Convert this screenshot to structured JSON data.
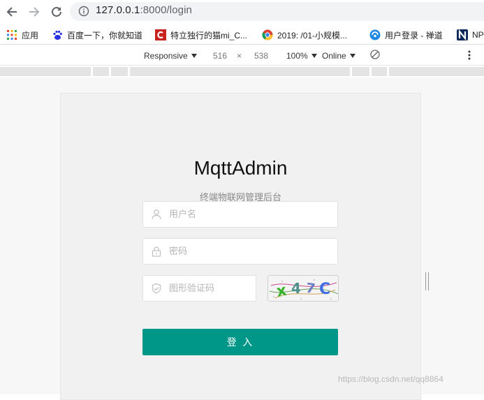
{
  "browser": {
    "url_host": "127.0.0.1",
    "url_path": ":8000/login",
    "bookmarks": [
      {
        "label": "应用",
        "icon": "apps-grid-icon"
      },
      {
        "label": "百度一下，你就知道",
        "icon": "baidu-paw-icon"
      },
      {
        "label": "特立独行的猫mi_C...",
        "icon": "csdn-c-icon"
      },
      {
        "label": "2019: /01-小规模...",
        "icon": "chrome-icon"
      },
      {
        "label": "用户登录 - 禅道",
        "icon": "zentao-icon"
      },
      {
        "label": "NP",
        "icon": "n-logo-icon"
      }
    ]
  },
  "devtools": {
    "device": "Responsive",
    "width": "516",
    "times": "×",
    "height": "538",
    "zoom": "100%",
    "network": "Online"
  },
  "login": {
    "title": "MqttAdmin",
    "subtitle": "终端物联网管理后台",
    "username_placeholder": "用户名",
    "password_placeholder": "密码",
    "captcha_placeholder": "图形验证码",
    "captcha_text": "x47C",
    "submit_label": "登 入"
  },
  "watermark": "https://blog.csdn.net/qq8864",
  "colors": {
    "accent": "#009688",
    "card_background": "#f1f1f1",
    "page_background": "#f7f7f7"
  }
}
